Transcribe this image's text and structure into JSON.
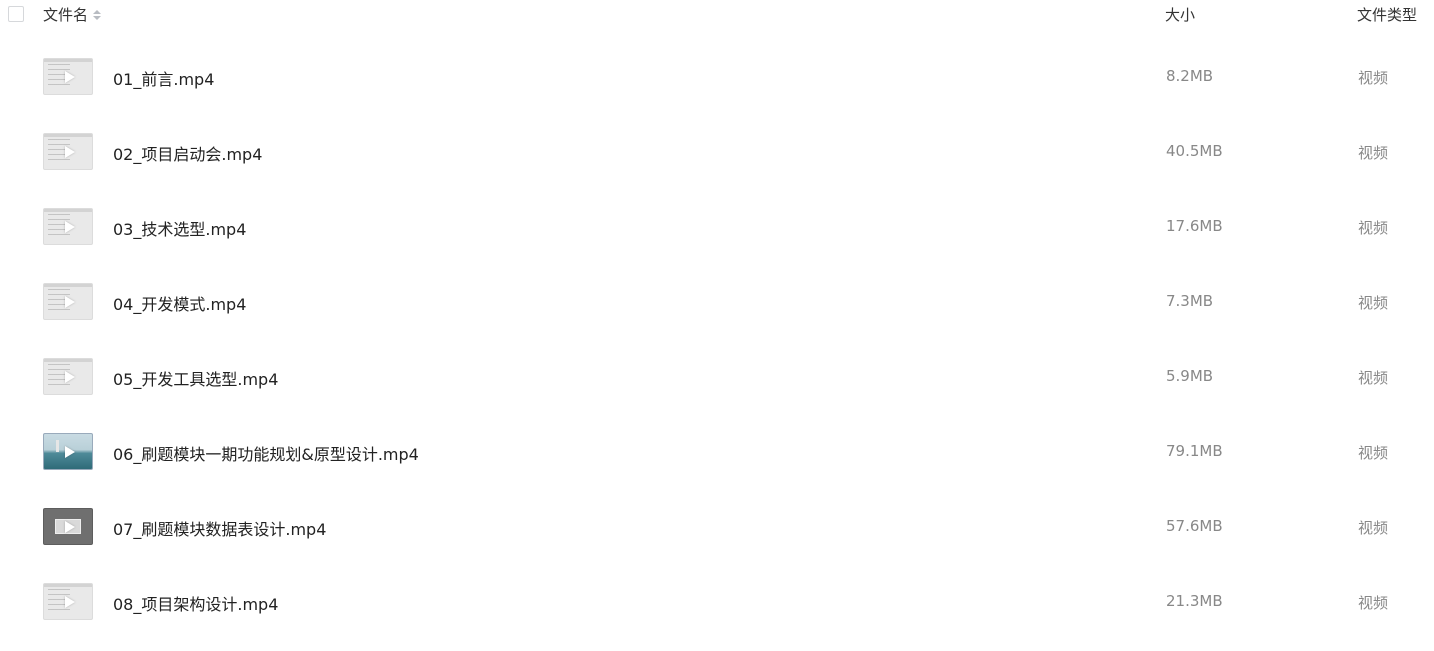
{
  "header": {
    "name_label": "文件名",
    "size_label": "大小",
    "type_label": "文件类型"
  },
  "files": [
    {
      "name": "01_前言.mp4",
      "size": "8.2MB",
      "type": "视频",
      "thumb": "document"
    },
    {
      "name": "02_项目启动会.mp4",
      "size": "40.5MB",
      "type": "视频",
      "thumb": "document"
    },
    {
      "name": "03_技术选型.mp4",
      "size": "17.6MB",
      "type": "视频",
      "thumb": "document"
    },
    {
      "name": "04_开发模式.mp4",
      "size": "7.3MB",
      "type": "视频",
      "thumb": "document"
    },
    {
      "name": "05_开发工具选型.mp4",
      "size": "5.9MB",
      "type": "视频",
      "thumb": "document"
    },
    {
      "name": "06_刷题模块一期功能规划&原型设计.mp4",
      "size": "79.1MB",
      "type": "视频",
      "thumb": "landscape"
    },
    {
      "name": "07_刷题模块数据表设计.mp4",
      "size": "57.6MB",
      "type": "视频",
      "thumb": "dark"
    },
    {
      "name": "08_项目架构设计.mp4",
      "size": "21.3MB",
      "type": "视频",
      "thumb": "document"
    }
  ]
}
